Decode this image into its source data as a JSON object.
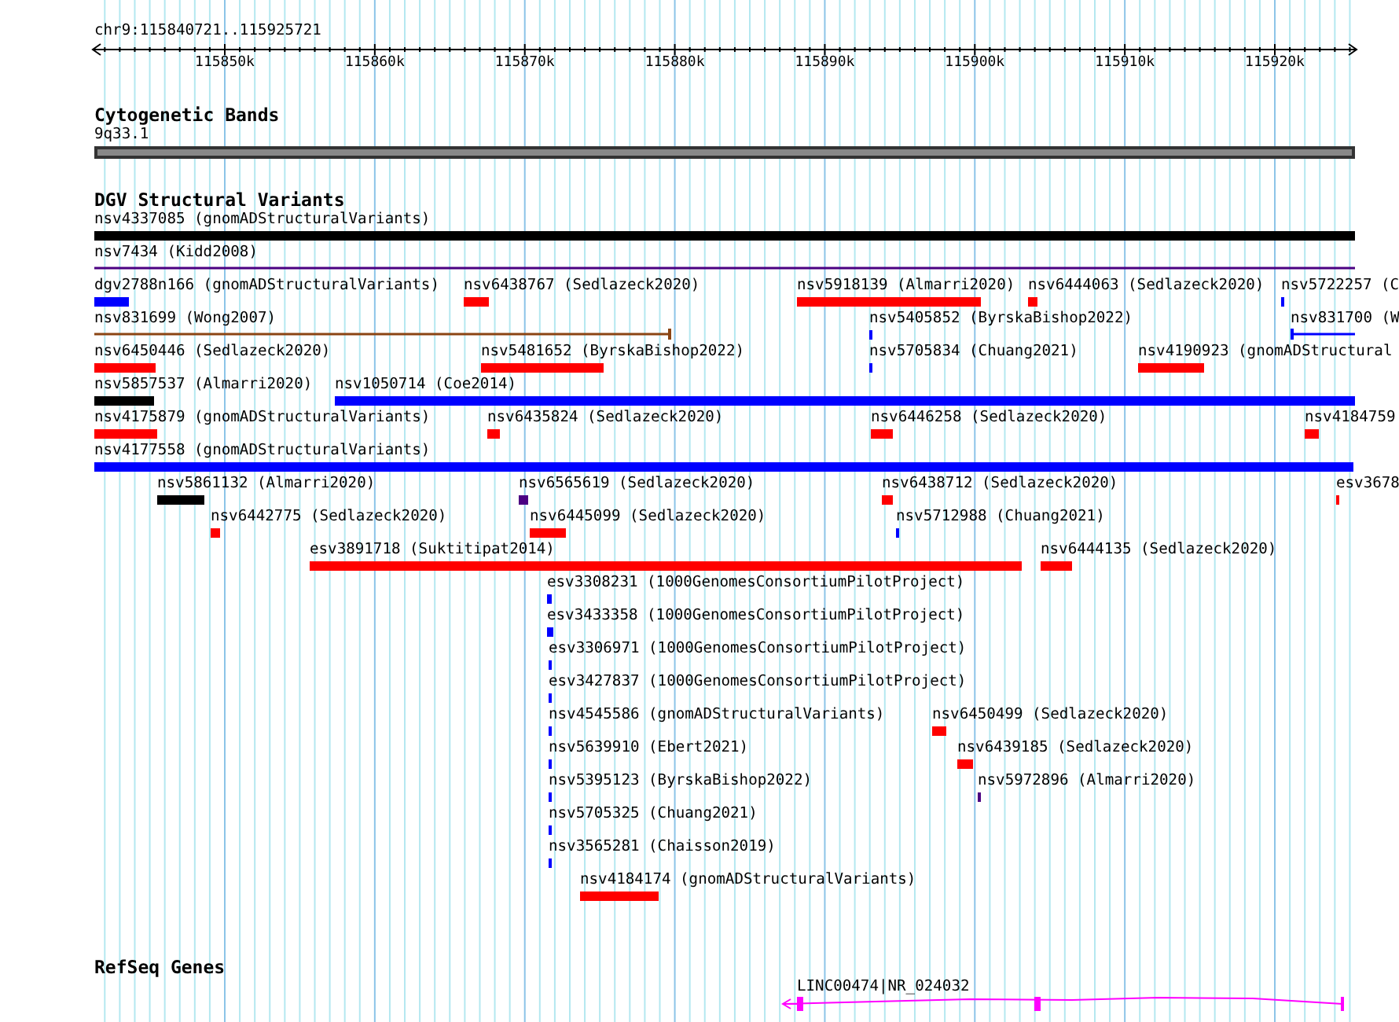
{
  "ruler": {
    "location": "chr9:115840721..115925721",
    "ticks": [
      "115850k",
      "115860k",
      "115870k",
      "115880k",
      "115890k",
      "115900k",
      "115910k",
      "115920k"
    ]
  },
  "cytogenetic_bands": {
    "title": "Cytogenetic Bands",
    "band": "9q33.1"
  },
  "dgv_structural_variants": {
    "title": "DGV Structural Variants",
    "features": [
      {
        "label": "nsv4337085 (gnomADStructuralVariants)",
        "color": "#000000",
        "kind": "bar"
      },
      {
        "label": "nsv7434 (Kidd2008)",
        "color": "#4b0082",
        "kind": "line"
      },
      {
        "label": "dgv2788n166 (gnomADStructuralVariants)",
        "color": "#0000ff",
        "kind": "bar"
      },
      {
        "label": "nsv6438767 (Sedlazeck2020)",
        "color": "#ff0000",
        "kind": "bar"
      },
      {
        "label": "nsv5918139 (Almarri2020)",
        "color": "#ff0000",
        "kind": "bar"
      },
      {
        "label": "nsv6444063 (Sedlazeck2020)",
        "color": "#ff0000",
        "kind": "bar"
      },
      {
        "label": "nsv5722257 (C",
        "color": "#0000ff",
        "kind": "bar"
      },
      {
        "label": "nsv831699 (Wong2007)",
        "color": "#8b4513",
        "kind": "line"
      },
      {
        "label": "nsv5405852 (ByrskaBishop2022)",
        "color": "#0000ff",
        "kind": "bar"
      },
      {
        "label": "nsv831700 (W",
        "color": "#0000ff",
        "kind": "line"
      },
      {
        "label": "nsv6450446 (Sedlazeck2020)",
        "color": "#ff0000",
        "kind": "bar"
      },
      {
        "label": "nsv5481652 (ByrskaBishop2022)",
        "color": "#ff0000",
        "kind": "bar"
      },
      {
        "label": "nsv5705834 (Chuang2021)",
        "color": "#0000ff",
        "kind": "bar"
      },
      {
        "label": "nsv4190923 (gnomADStructural",
        "color": "#ff0000",
        "kind": "bar"
      },
      {
        "label": "nsv5857537 (Almarri2020)",
        "color": "#000000",
        "kind": "bar"
      },
      {
        "label": "nsv1050714 (Coe2014)",
        "color": "#0000ff",
        "kind": "bar"
      },
      {
        "label": "nsv4175879 (gnomADStructuralVariants)",
        "color": "#ff0000",
        "kind": "bar"
      },
      {
        "label": "nsv6435824 (Sedlazeck2020)",
        "color": "#ff0000",
        "kind": "bar"
      },
      {
        "label": "nsv6446258 (Sedlazeck2020)",
        "color": "#ff0000",
        "kind": "bar"
      },
      {
        "label": "nsv4184759",
        "color": "#ff0000",
        "kind": "bar"
      },
      {
        "label": "nsv4177558 (gnomADStructuralVariants)",
        "color": "#0000ff",
        "kind": "bar"
      },
      {
        "label": "nsv5861132 (Almarri2020)",
        "color": "#000000",
        "kind": "bar"
      },
      {
        "label": "nsv6565619 (Sedlazeck2020)",
        "color": "#4b0082",
        "kind": "bar"
      },
      {
        "label": "nsv6438712 (Sedlazeck2020)",
        "color": "#ff0000",
        "kind": "bar"
      },
      {
        "label": "esv3678",
        "color": "#ff0000",
        "kind": "bar"
      },
      {
        "label": "nsv6442775 (Sedlazeck2020)",
        "color": "#ff0000",
        "kind": "bar"
      },
      {
        "label": "nsv6445099 (Sedlazeck2020)",
        "color": "#ff0000",
        "kind": "bar"
      },
      {
        "label": "nsv5712988 (Chuang2021)",
        "color": "#0000ff",
        "kind": "bar"
      },
      {
        "label": "esv3891718 (Suktitipat2014)",
        "color": "#ff0000",
        "kind": "bar"
      },
      {
        "label": "nsv6444135 (Sedlazeck2020)",
        "color": "#ff0000",
        "kind": "bar"
      },
      {
        "label": "esv3308231 (1000GenomesConsortiumPilotProject)",
        "color": "#0000ff",
        "kind": "bar"
      },
      {
        "label": "esv3433358 (1000GenomesConsortiumPilotProject)",
        "color": "#0000ff",
        "kind": "bar"
      },
      {
        "label": "esv3306971 (1000GenomesConsortiumPilotProject)",
        "color": "#0000ff",
        "kind": "bar"
      },
      {
        "label": "esv3427837 (1000GenomesConsortiumPilotProject)",
        "color": "#0000ff",
        "kind": "bar"
      },
      {
        "label": "nsv4545586 (gnomADStructuralVariants)",
        "color": "#0000ff",
        "kind": "bar"
      },
      {
        "label": "nsv6450499 (Sedlazeck2020)",
        "color": "#ff0000",
        "kind": "bar"
      },
      {
        "label": "nsv5639910 (Ebert2021)",
        "color": "#0000ff",
        "kind": "bar"
      },
      {
        "label": "nsv6439185 (Sedlazeck2020)",
        "color": "#ff0000",
        "kind": "bar"
      },
      {
        "label": "nsv5395123 (ByrskaBishop2022)",
        "color": "#0000ff",
        "kind": "bar"
      },
      {
        "label": "nsv5972896 (Almarri2020)",
        "color": "#4b0082",
        "kind": "bar"
      },
      {
        "label": "nsv5705325 (Chuang2021)",
        "color": "#0000ff",
        "kind": "bar"
      },
      {
        "label": "nsv3565281 (Chaisson2019)",
        "color": "#0000ff",
        "kind": "bar"
      },
      {
        "label": "nsv4184174 (gnomADStructuralVariants)",
        "color": "#ff0000",
        "kind": "bar"
      }
    ]
  },
  "refseq_genes": {
    "title": "RefSeq Genes",
    "genes": [
      {
        "label": "LINC00474|NR_024032"
      }
    ]
  }
}
